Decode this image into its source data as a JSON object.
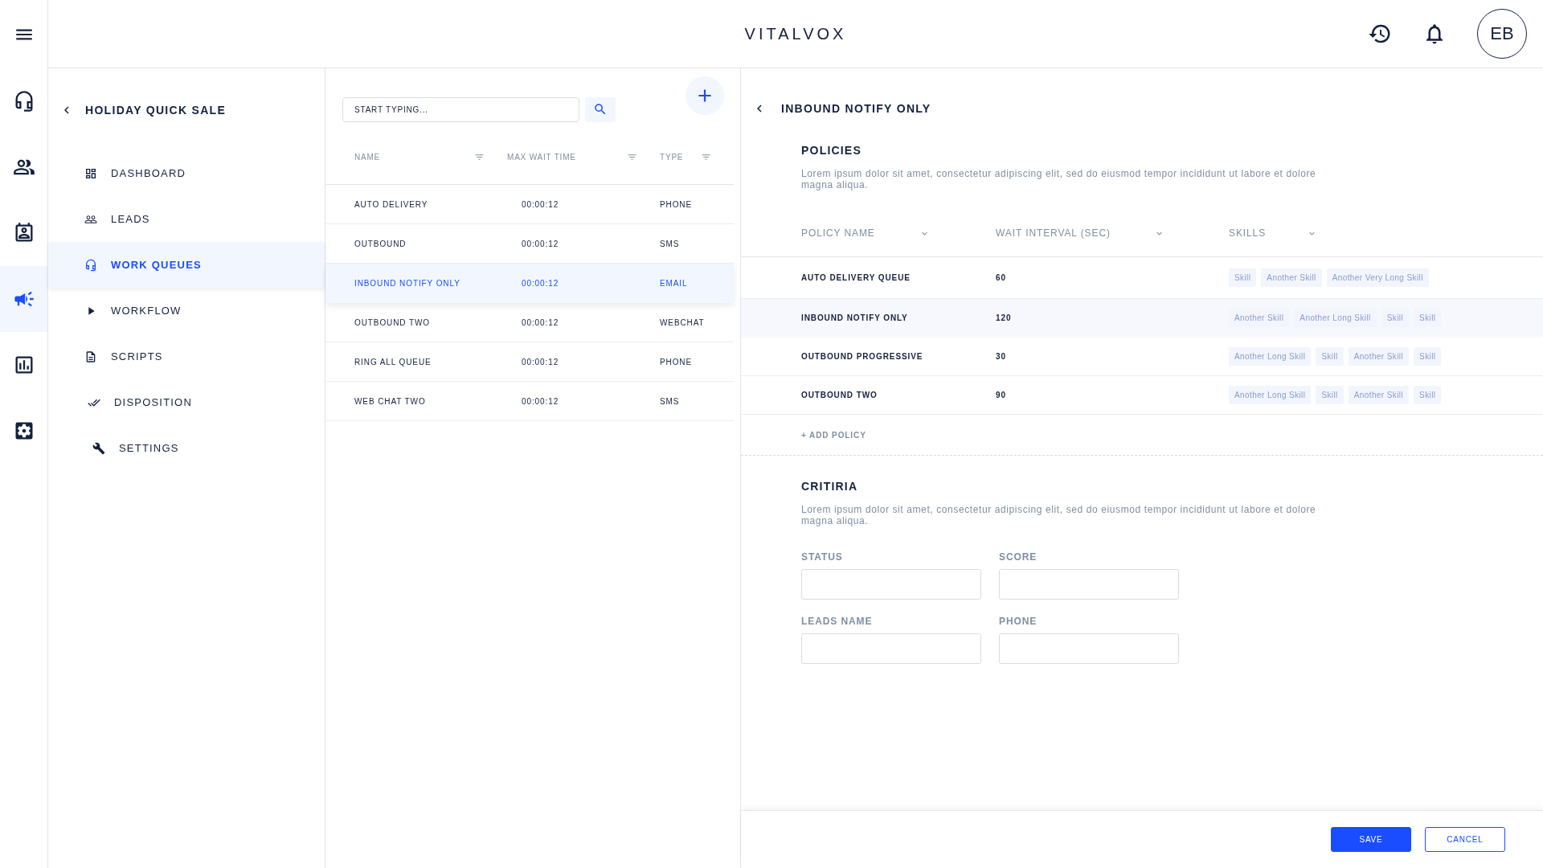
{
  "header": {
    "brand": "VITALVOX",
    "avatar": "EB"
  },
  "rail": [
    {
      "selected": false
    },
    {
      "selected": false
    },
    {
      "selected": false
    },
    {
      "selected": true
    },
    {
      "selected": false
    },
    {
      "selected": false
    }
  ],
  "sidebar": {
    "title": "HOLIDAY QUICK SALE",
    "items": [
      {
        "label": "DASHBOARD",
        "selected": false
      },
      {
        "label": "LEADS",
        "selected": false
      },
      {
        "label": "WORK QUEUES",
        "selected": true
      },
      {
        "label": "WORKFLOW",
        "selected": false
      },
      {
        "label": "SCRIPTS",
        "selected": false
      },
      {
        "label": "DISPOSITION",
        "selected": false
      },
      {
        "label": "SETTINGS",
        "selected": false
      }
    ]
  },
  "queues": {
    "search": {
      "placeholder": "START TYPING..."
    },
    "columns": [
      "NAME",
      "MAX WAIT TIME",
      "TYPE"
    ],
    "rows": [
      {
        "name": "AUTO DELIVERY",
        "wait": "00:00:12",
        "type": "PHONE",
        "selected": false
      },
      {
        "name": "OUTBOUND",
        "wait": "00:00:12",
        "type": "SMS",
        "selected": false
      },
      {
        "name": "INBOUND NOTIFY ONLY",
        "wait": "00:00:12",
        "type": "EMAIL",
        "selected": true
      },
      {
        "name": "OUTBOUND TWO",
        "wait": "00:00:12",
        "type": "WEBCHAT",
        "selected": false
      },
      {
        "name": "RING ALL QUEUE",
        "wait": "00:00:12",
        "type": "PHONE",
        "selected": false
      },
      {
        "name": "WEB CHAT TWO",
        "wait": "00:00:12",
        "type": "SMS",
        "selected": false
      }
    ]
  },
  "detail": {
    "title": "INBOUND NOTIFY ONLY",
    "policies": {
      "title": "POLICIES",
      "description": "Lorem ipsum dolor sit amet, consectetur adipiscing elit, sed do eiusmod tempor incididunt ut labore et dolore magna aliqua.",
      "columns": [
        "POLICY NAME",
        "WAIT INTERVAL (SEC)",
        "SKILLS"
      ],
      "rows": [
        {
          "name": "AUTO DELIVERY QUEUE",
          "interval": "60",
          "skills": [
            "Skill",
            "Another Skill",
            "Another Very Long Skill"
          ],
          "selected": false
        },
        {
          "name": "INBOUND NOTIFY ONLY",
          "interval": "120",
          "skills": [
            "Another Skill",
            "Another Long Skill",
            "Skill",
            "Skill"
          ],
          "selected": true
        },
        {
          "name": "OUTBOUND PROGRESSIVE",
          "interval": "30",
          "skills": [
            "Another Long Skill",
            "Skill",
            "Another Skill",
            "Skill"
          ],
          "selected": false
        },
        {
          "name": "OUTBOUND TWO",
          "interval": "90",
          "skills": [
            "Another Long Skill",
            "Skill",
            "Another Skill",
            "Skill"
          ],
          "selected": false
        }
      ],
      "add": "+ ADD POLICY"
    },
    "criteria": {
      "title": "CRITIRIA",
      "description": "Lorem ipsum dolor sit amet, consectetur adipiscing elit, sed do eiusmod tempor incididunt ut labore et dolore magna aliqua.",
      "fields": [
        {
          "label": "STATUS"
        },
        {
          "label": "SCORE"
        },
        {
          "label": "LEADS NAME"
        },
        {
          "label": "PHONE"
        }
      ]
    },
    "buttons": {
      "save": "SAVE",
      "cancel": "CANCEL"
    }
  }
}
